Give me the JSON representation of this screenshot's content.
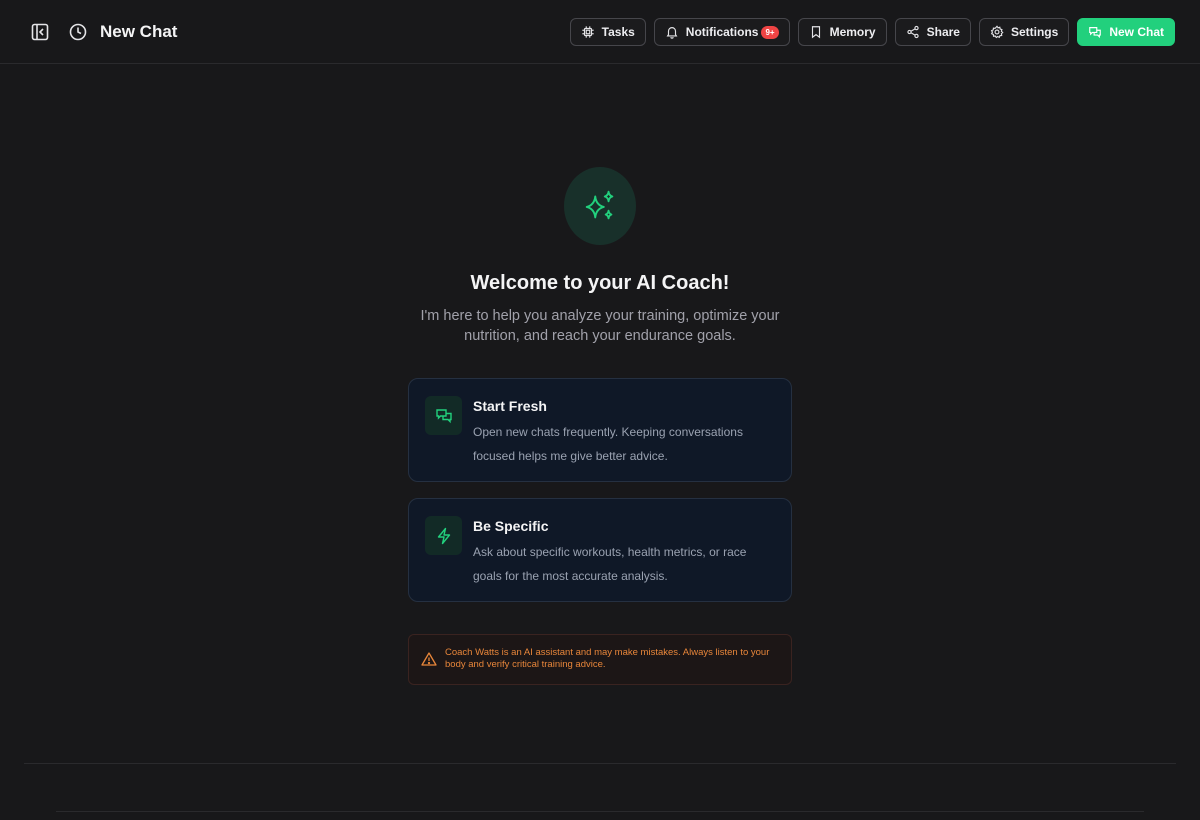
{
  "header": {
    "title": "New Chat",
    "buttons": {
      "tasks": "Tasks",
      "notifications": "Notifications",
      "notifications_badge": "9+",
      "memory": "Memory",
      "share": "Share",
      "settings": "Settings",
      "new_chat": "New Chat"
    }
  },
  "welcome": {
    "title": "Welcome to your AI Coach!",
    "subtitle": "I'm here to help you analyze your training, optimize your nutrition, and reach your endurance goals."
  },
  "tips": [
    {
      "icon": "chat-bubbles-icon",
      "title": "Start Fresh",
      "description": "Open new chats frequently. Keeping conversations focused helps me give better advice."
    },
    {
      "icon": "lightning-icon",
      "title": "Be Specific",
      "description": "Ask about specific workouts, health metrics, or race goals for the most accurate analysis."
    }
  ],
  "disclaimer": {
    "icon": "warning-triangle-icon",
    "text": "Coach Watts is an AI assistant and may make mistakes. Always listen to your body and verify critical training advice."
  },
  "colors": {
    "background": "#18181a",
    "accent": "#22d07d",
    "badge": "#ef4444",
    "warning": "#e8863a",
    "card_background": "#0f1827"
  }
}
